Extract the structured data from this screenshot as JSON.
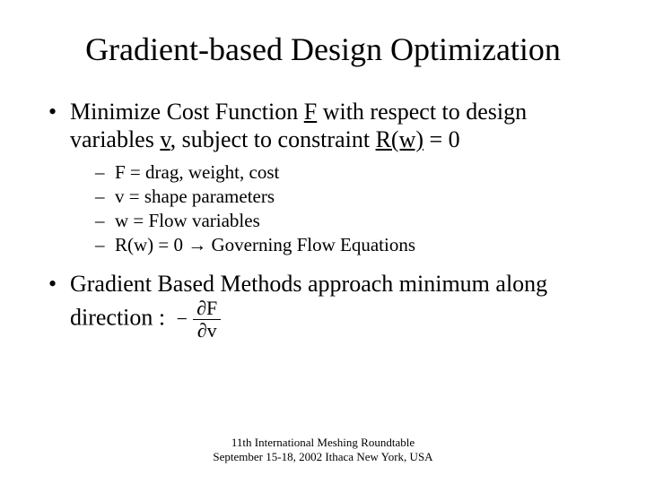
{
  "title": "Gradient-based Design Optimization",
  "bullet1": {
    "pre1": "Minimize Cost Function ",
    "uF": "F",
    "mid1": " with respect to design variables ",
    "uv": "v",
    "mid2": ", subject to constraint ",
    "uR": "R(w)",
    "tail": " = 0",
    "sub": {
      "a": "F = drag, weight, cost",
      "b": "v = shape parameters",
      "c": "w = Flow variables",
      "d_pre": "R(w) = 0 ",
      "d_arrow": "→",
      "d_post": " Governing Flow Equations"
    }
  },
  "bullet2": {
    "text": "Gradient Based Methods approach minimum along direction :",
    "fraction": {
      "minus": "−",
      "num_partial": "∂",
      "num_sym": "F",
      "den_partial": "∂",
      "den_sym": "v"
    }
  },
  "footer": {
    "line1": "11th International Meshing Roundtable",
    "line2": "September 15-18, 2002 Ithaca New York, USA"
  }
}
